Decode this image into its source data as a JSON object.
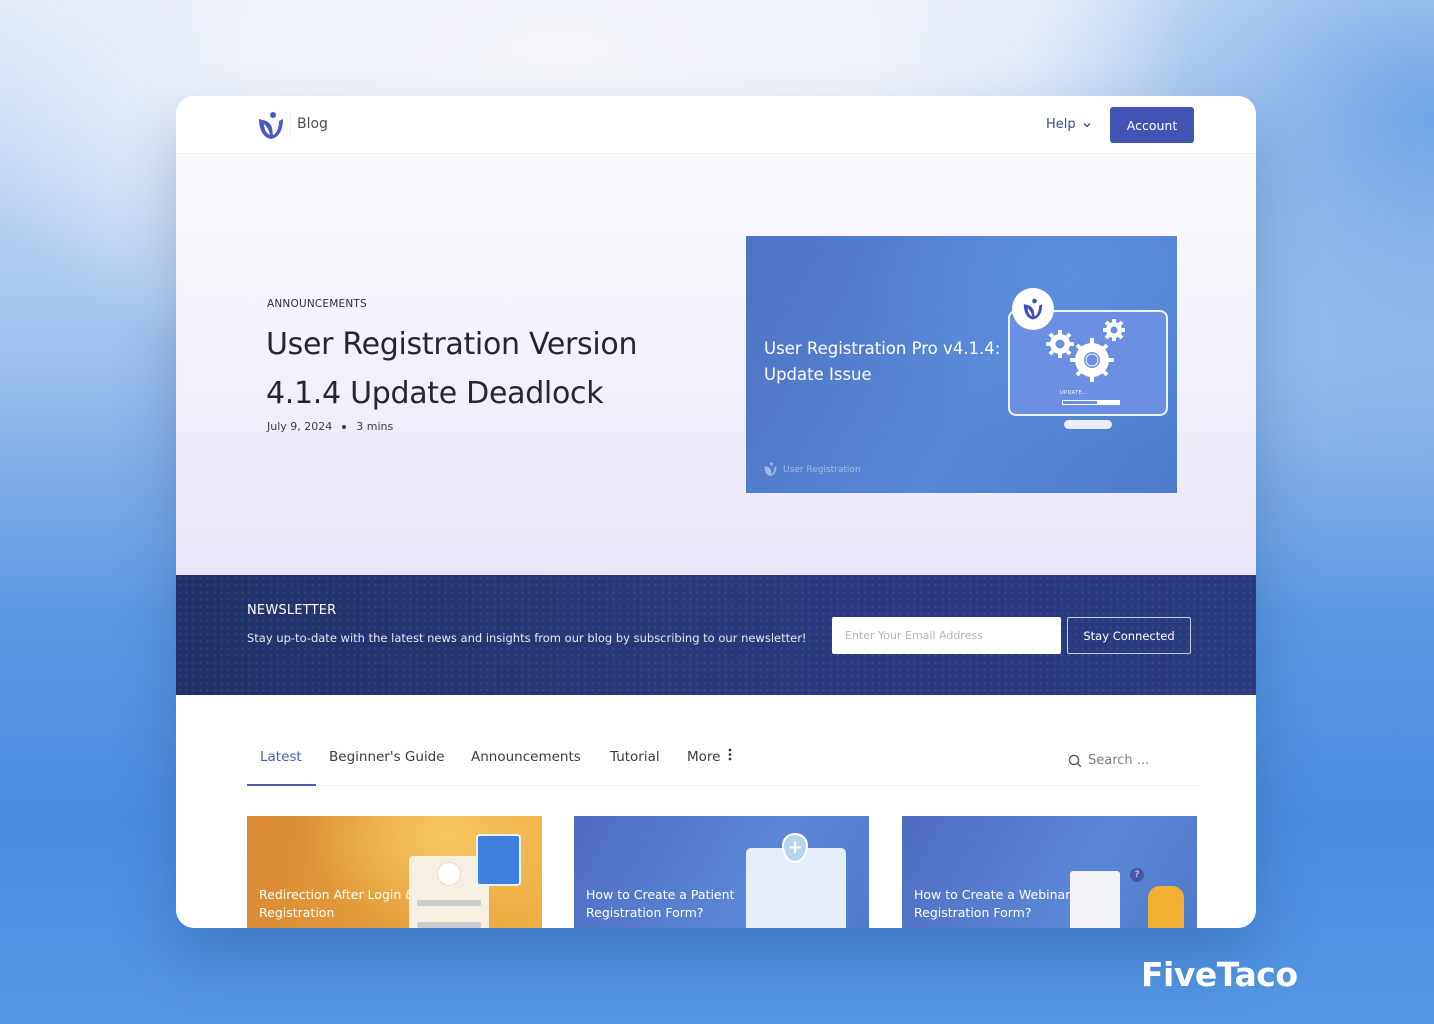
{
  "header": {
    "site_section": "Blog",
    "help_label": "Help",
    "account_label": "Account"
  },
  "hero": {
    "category": "ANNOUNCEMENTS",
    "title": "User Registration Version 4.1.4 Update Deadlock",
    "date": "July 9, 2024",
    "read_time": "3 mins",
    "image": {
      "title": "User Registration Pro v4.1.4: Update Issue",
      "brand": "User Registration",
      "status_text": "UPDATE...",
      "progress": 0.6
    }
  },
  "newsletter": {
    "title": "NEWSLETTER",
    "description": "Stay up-to-date with the latest news and insights from our blog by subscribing to our newsletter!",
    "email_placeholder": "Enter Your Email Address",
    "email_value": "",
    "button_label": "Stay Connected"
  },
  "tabs": {
    "items": [
      {
        "label": "Latest",
        "active": true
      },
      {
        "label": "Beginner's Guide",
        "active": false
      },
      {
        "label": "Announcements",
        "active": false
      },
      {
        "label": "Tutorial",
        "active": false
      },
      {
        "label": "More",
        "active": false
      }
    ],
    "search_placeholder": "Search ..."
  },
  "cards": [
    {
      "title": "Redirection After Login & Registration"
    },
    {
      "title": "How to Create a Patient Registration Form?"
    },
    {
      "title": "How to Create a Webinar Registration Form?"
    }
  ],
  "watermark": "FiveTaco",
  "colors": {
    "accent": "#4353b3",
    "newsletter_bg": "#273574",
    "tab_active": "#4a5cb8"
  }
}
